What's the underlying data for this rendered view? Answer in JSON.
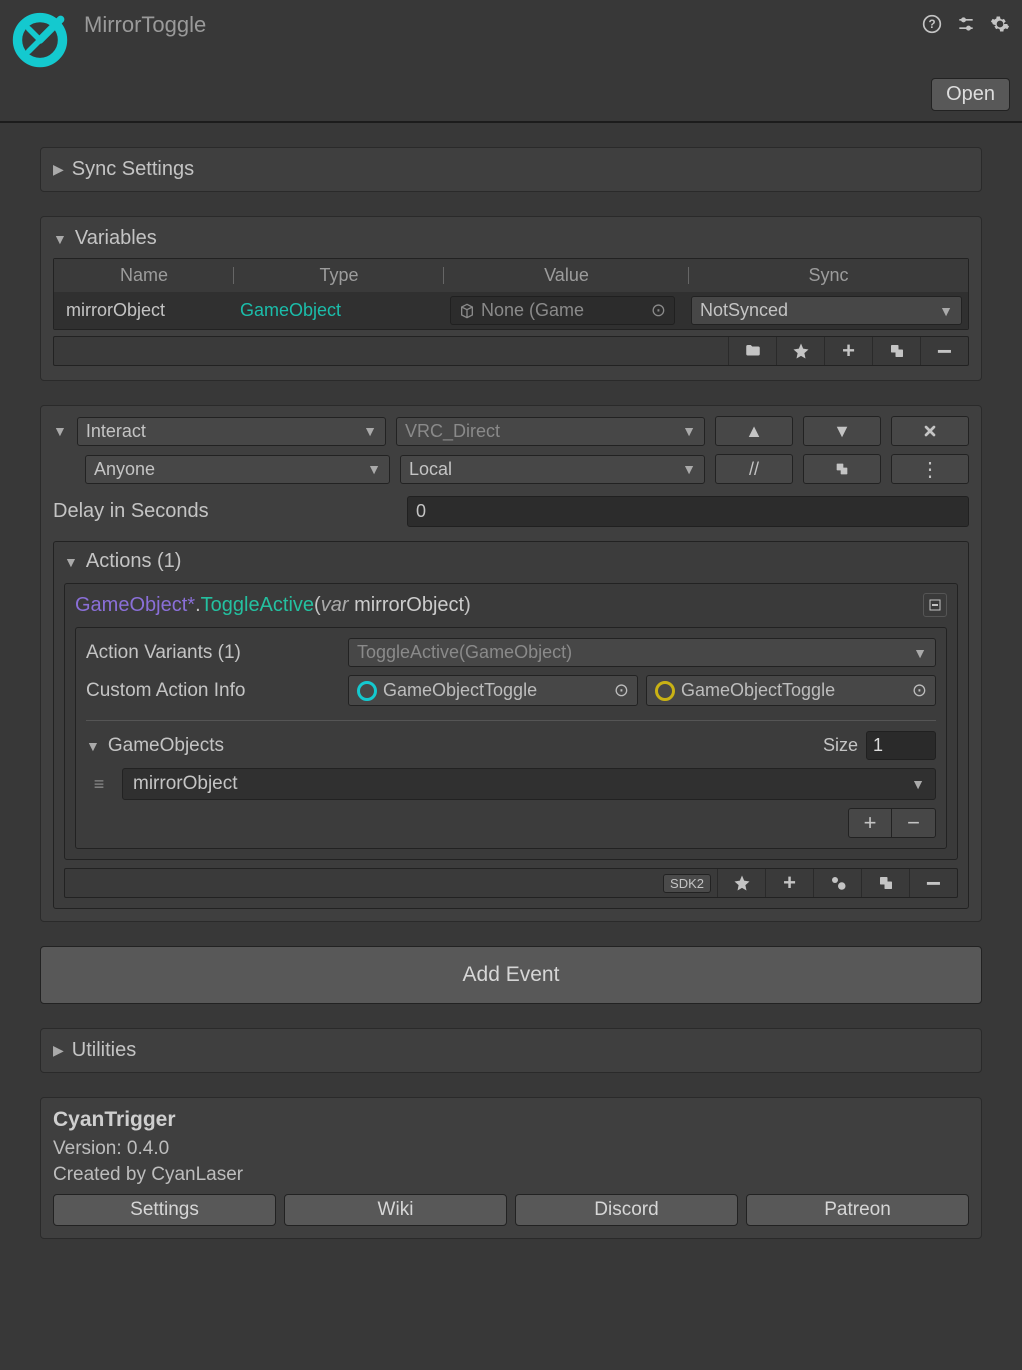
{
  "header": {
    "title": "MirrorToggle",
    "open_label": "Open"
  },
  "sync_settings": {
    "label": "Sync Settings"
  },
  "variables": {
    "label": "Variables",
    "columns": {
      "name": "Name",
      "type": "Type",
      "value": "Value",
      "sync": "Sync"
    },
    "rows": [
      {
        "name": "mirrorObject",
        "type": "GameObject",
        "value": "None (Game",
        "sync": "NotSynced"
      }
    ]
  },
  "event": {
    "trigger": "Interact",
    "broadcast": "VRC_Direct",
    "userGate": "Anyone",
    "target": "Local",
    "row2_btn_slashes": "//",
    "delay_label": "Delay in Seconds",
    "delay_value": "0",
    "actions_label": "Actions (1)",
    "action_sig": {
      "cls": "GameObject*",
      "dot": ".",
      "mth": "ToggleActive",
      "open": "(",
      "kw": "var",
      "sp": " ",
      "varname": "mirrorObject",
      "close": ")"
    },
    "variants_label": "Action Variants (1)",
    "variants_value": "ToggleActive(GameObject)",
    "info_label": "Custom Action Info",
    "info_chip1": "GameObjectToggle",
    "info_chip2": "GameObjectToggle",
    "gameobjects_label": "GameObjects",
    "size_label": "Size",
    "size_value": "1",
    "go_item": "mirrorObject",
    "sdk_tag": "SDK2"
  },
  "add_event_label": "Add Event",
  "utilities": {
    "label": "Utilities"
  },
  "footer": {
    "title": "CyanTrigger",
    "version": "Version: 0.4.0",
    "author": "Created by CyanLaser",
    "buttons": {
      "settings": "Settings",
      "wiki": "Wiki",
      "discord": "Discord",
      "patreon": "Patreon"
    }
  }
}
